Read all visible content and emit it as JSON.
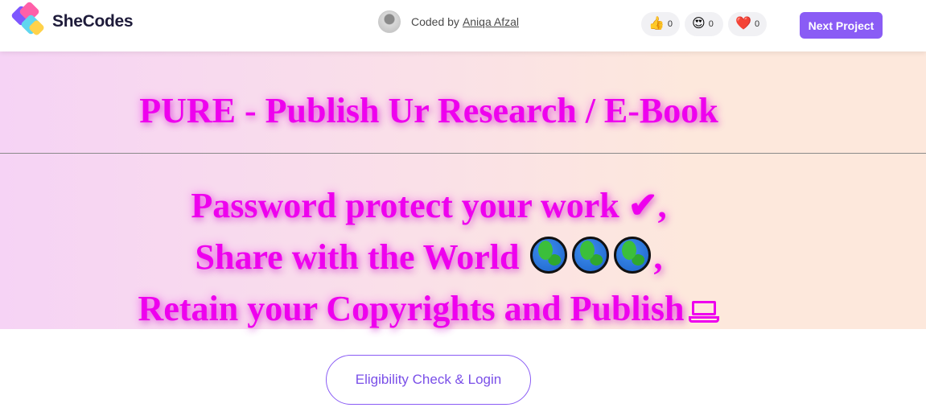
{
  "header": {
    "brand": "SheCodes",
    "coded_by_prefix": "Coded by",
    "author_name": "Aniqa Afzal",
    "reactions": [
      {
        "icon": "thumbs-up-icon",
        "emoji": "👍",
        "count": "0"
      },
      {
        "icon": "heart-eyes-icon",
        "emoji": "😍",
        "count": "0"
      },
      {
        "icon": "heart-icon",
        "emoji": "❤️",
        "count": "0"
      }
    ],
    "next_project_label": "Next Project",
    "accent_color": "#8a5cf5"
  },
  "hero": {
    "title": "PURE - Publish Ur Research / E-Book",
    "line1": "Password protect your work ✔,",
    "line2_text": "Share with the World",
    "line2_suffix": ",",
    "line3_text": "Retain your Copyrights and Publish",
    "text_color": "#ee00ee"
  },
  "cta": {
    "label": "Eligibility Check & Login"
  }
}
